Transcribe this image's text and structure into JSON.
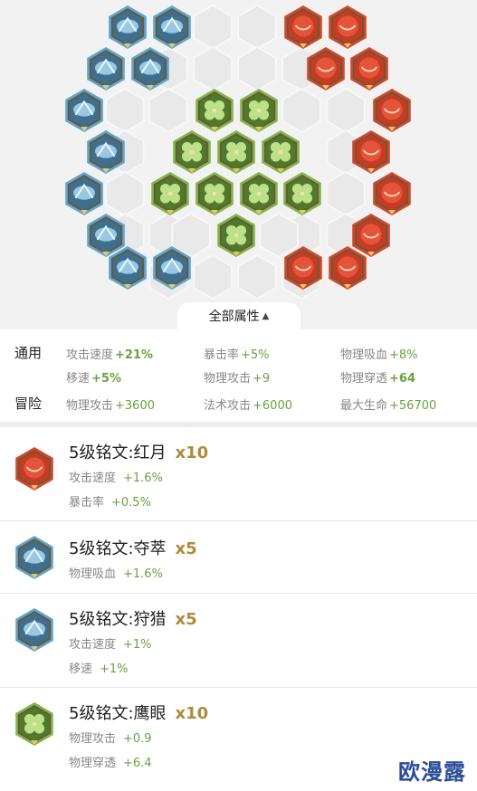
{
  "board": {
    "expand_label": "全部属性",
    "expand_icon": "chevron-up-icon"
  },
  "attributes": {
    "general": {
      "label": "通用",
      "items": [
        {
          "name": "攻击速度",
          "value": "+21%"
        },
        {
          "name": "暴击率",
          "value": "+5%"
        },
        {
          "name": "物理吸血",
          "value": "+8%"
        },
        {
          "name": "移速",
          "value": "+5%"
        },
        {
          "name": "物理攻击",
          "value": "+9"
        },
        {
          "name": "物理穿透",
          "value": "+64"
        }
      ]
    },
    "adventure": {
      "label": "冒险",
      "items": [
        {
          "name": "物理攻击",
          "value": "+3600"
        },
        {
          "name": "法术攻击",
          "value": "+6000"
        },
        {
          "name": "最大生命",
          "value": "+56700"
        }
      ]
    }
  },
  "runes": [
    {
      "title": "5级铭文:红月",
      "count": "x10",
      "color": "red",
      "stats": [
        {
          "name": "攻击速度",
          "value": "+1.6%"
        },
        {
          "name": "暴击率",
          "value": "+0.5%"
        }
      ]
    },
    {
      "title": "5级铭文:夺萃",
      "count": "x5",
      "color": "blue",
      "stats": [
        {
          "name": "物理吸血",
          "value": "+1.6%"
        }
      ]
    },
    {
      "title": "5级铭文:狩猎",
      "count": "x5",
      "color": "blue",
      "stats": [
        {
          "name": "攻击速度",
          "value": "+1%"
        },
        {
          "name": "移速",
          "value": "+1%"
        }
      ]
    },
    {
      "title": "5级铭文:鹰眼",
      "count": "x10",
      "color": "green",
      "stats": [
        {
          "name": "物理攻击",
          "value": "+0.9"
        },
        {
          "name": "物理穿透",
          "value": "+6.4"
        }
      ]
    }
  ],
  "watermark": "欧漫露",
  "colors": {
    "red": "#d9452b",
    "blue": "#5aa7d6",
    "green": "#7fb84a",
    "gold": "#b08a3c",
    "value_green": "#6aa043"
  }
}
